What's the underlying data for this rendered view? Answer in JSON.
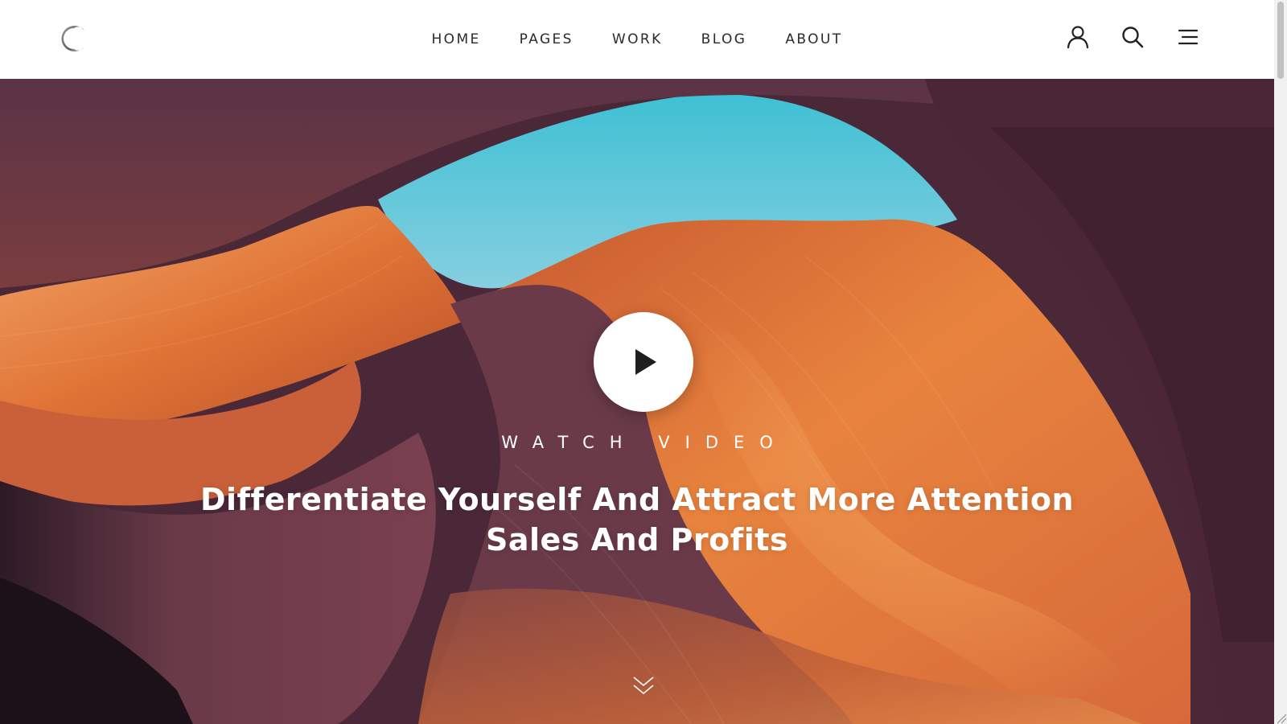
{
  "nav": {
    "items": [
      {
        "label": "HOME"
      },
      {
        "label": "PAGES"
      },
      {
        "label": "WORK"
      },
      {
        "label": "BLOG"
      },
      {
        "label": "ABOUT"
      }
    ]
  },
  "header_icons": [
    "user-icon",
    "search-icon",
    "menu-icon"
  ],
  "hero": {
    "watch_label": "WATCH VIDEO",
    "headline_line1": "Differentiate Yourself And Attract More Attention",
    "headline_line2": "Sales And Profits"
  },
  "colors": {
    "sky": "#5cc0d3",
    "rock_orange": "#e07a3c",
    "rock_purple": "#4a2838",
    "text_dark": "#2b2b2b",
    "white": "#ffffff"
  }
}
